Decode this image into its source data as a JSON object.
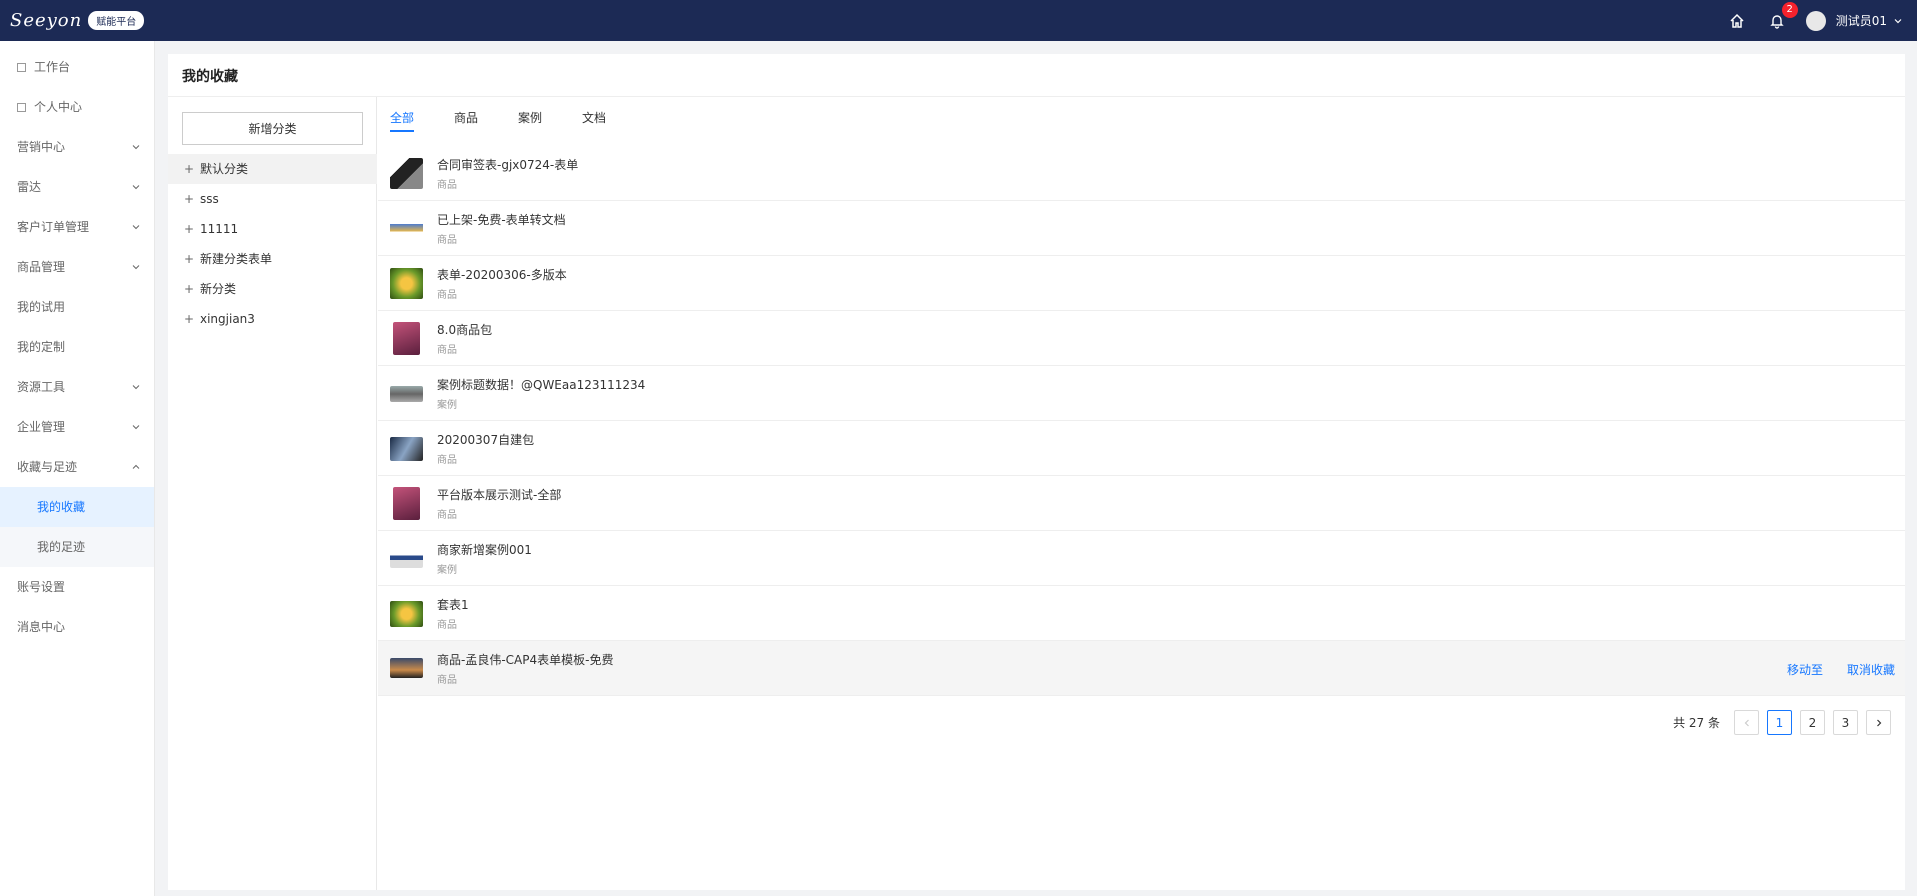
{
  "header": {
    "logo_text": "Seeyon",
    "platform_badge": "赋能平台",
    "notification_count": "2",
    "username": "测试员01"
  },
  "sidebar": {
    "items": [
      {
        "label": "工作台"
      },
      {
        "label": "个人中心"
      },
      {
        "label": "营销中心"
      },
      {
        "label": "雷达"
      },
      {
        "label": "客户订单管理"
      },
      {
        "label": "商品管理"
      },
      {
        "label": "我的试用"
      },
      {
        "label": "我的定制"
      },
      {
        "label": "资源工具"
      },
      {
        "label": "企业管理"
      },
      {
        "label": "收藏与足迹"
      },
      {
        "label": "我的收藏"
      },
      {
        "label": "我的足迹"
      },
      {
        "label": "账号设置"
      },
      {
        "label": "消息中心"
      }
    ]
  },
  "page": {
    "title": "我的收藏",
    "add_category": "新增分类"
  },
  "categories": [
    {
      "label": "默认分类"
    },
    {
      "label": "sss"
    },
    {
      "label": "11111"
    },
    {
      "label": "新建分类表单"
    },
    {
      "label": "新分类"
    },
    {
      "label": "xingjian3"
    }
  ],
  "tabs": [
    {
      "label": "全部"
    },
    {
      "label": "商品"
    },
    {
      "label": "案例"
    },
    {
      "label": "文档"
    }
  ],
  "favorites": [
    {
      "title": "合同审签表-gjx0724-表单",
      "type": "商品"
    },
    {
      "title": "已上架-免费-表单转文档",
      "type": "商品"
    },
    {
      "title": "表单-20200306-多版本",
      "type": "商品"
    },
    {
      "title": "8.0商品包",
      "type": "商品"
    },
    {
      "title": "案例标题数据！@QWEaa123111234",
      "type": "案例"
    },
    {
      "title": "20200307自建包",
      "type": "商品"
    },
    {
      "title": "平台版本展示测试-全部",
      "type": "商品"
    },
    {
      "title": "商家新增案例001",
      "type": "案例"
    },
    {
      "title": "套表1",
      "type": "商品"
    },
    {
      "title": "商品-孟良伟-CAP4表单模板-免费",
      "type": "商品"
    }
  ],
  "row_actions": {
    "move_to": "移动至",
    "unfavorite": "取消收藏"
  },
  "pagination": {
    "total": "共 27 条",
    "pages": [
      "1",
      "2",
      "3"
    ],
    "current": "1"
  },
  "colors": {
    "header_bg": "#1c2a55",
    "accent": "#1677ff",
    "badge": "#f5222d"
  }
}
